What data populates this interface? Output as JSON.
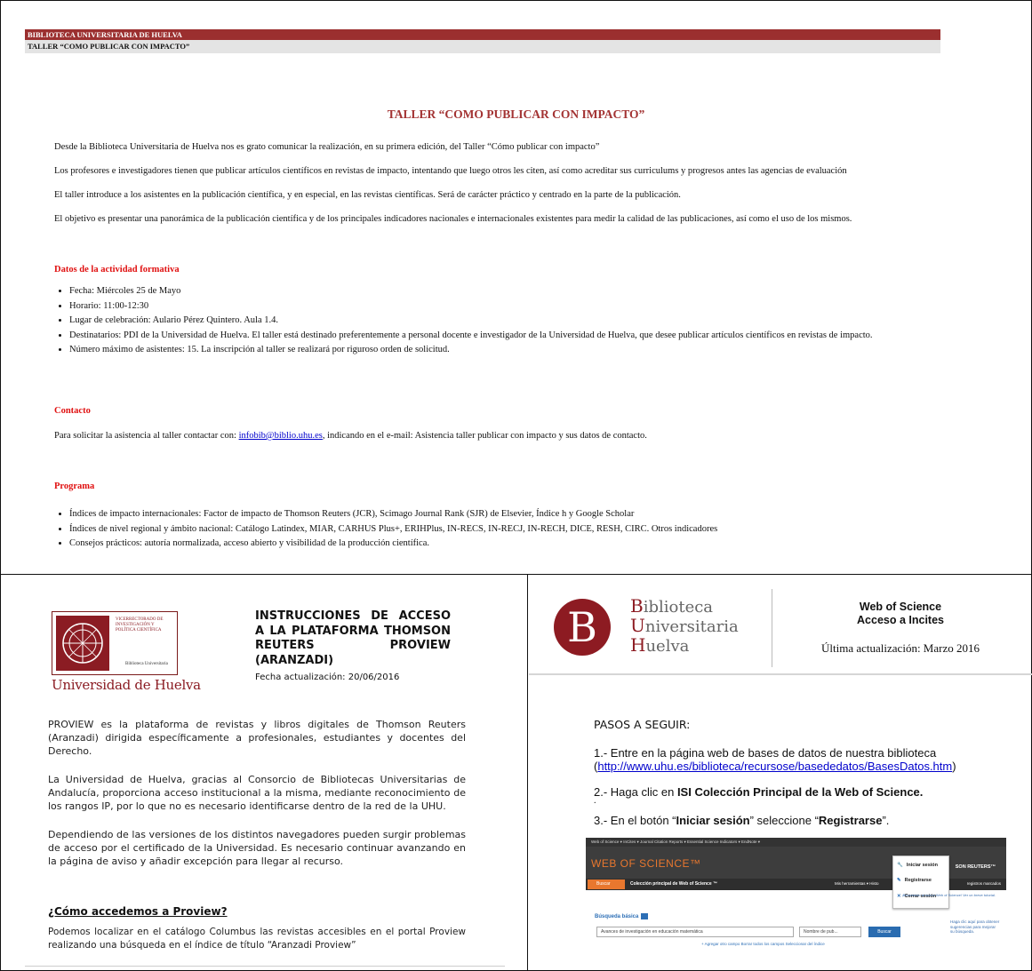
{
  "top": {
    "header_red": "BIBLIOTECA UNIVERSITARIA DE HUELVA",
    "header_grey": "TALLER “COMO PUBLICAR CON IMPACTO”",
    "title": "TALLER “COMO PUBLICAR CON IMPACTO”",
    "paragraphs": [
      "Desde la Biblioteca Universitaria de Huelva nos es grato comunicar la realización, en su primera edición, del Taller “Cómo publicar con impacto”",
      "Los profesores e investigadores tienen que publicar artículos científicos en revistas de impacto, intentando que luego otros les citen, así como acreditar sus curriculums y progresos antes las agencias de evaluación",
      "El taller introduce a los asistentes en la publicación científica, y en especial, en las revistas científicas. Será de carácter práctico y centrado en la parte de la publicación.",
      "El objetivo es presentar una panorámica de la publicación científica y de los principales indicadores nacionales e internacionales existentes para medir la calidad de las publicaciones, así como el uso de los mismos."
    ],
    "section_datos": "Datos de la actividad formativa",
    "datos": [
      "Fecha: Miércoles 25 de Mayo",
      "Horario: 11:00-12:30",
      "Lugar de celebración: Aulario Pérez Quintero. Aula 1.4.",
      "Destinatarios: PDI de la Universidad de Huelva. El taller está destinado preferentemente a personal docente e investigador de la Universidad de Huelva, que desee publicar artículos científicos en revistas de impacto.",
      "Número máximo de asistentes: 15. La inscripción al taller se realizará por riguroso orden de solicitud."
    ],
    "section_contacto": "Contacto",
    "contact_pre": "Para solicitar la asistencia al taller contactar con: ",
    "contact_email": "infobib@biblio.uhu.es",
    "contact_post": ", indicando en el e-mail: Asistencia taller publicar con impacto y sus datos de contacto.",
    "section_programa": "Programa",
    "programa": [
      "Índices de impacto internacionales: Factor de impacto de Thomson Reuters (JCR), Scimago Journal Rank (SJR) de Elsevier, Índice h y Google Scholar",
      "Índices de nivel regional y ámbito nacional: Catálogo Latindex, MIAR, CARHUS Plus+, ERIHPlus, IN-RECS, IN-RECJ, IN-RECH, DICE, RESH, CIRC. Otros indicadores",
      "Consejos prácticos: autoría normalizada, acceso abierto y visibilidad de la producción científica."
    ]
  },
  "bottom_left": {
    "logo_vr": "Vicerrectorado de Investigación y Política Científica",
    "logo_bu": "Biblioteca Universitaria",
    "logo_name": "Universidad de Huelva",
    "title": "INSTRUCCIONES DE ACCESO A LA PLATAFORMA THOMSON REUTERS PROVIEW (ARANZADI)",
    "date": "Fecha actualización: 20/06/2016",
    "p1": "PROVIEW es la plataforma de revistas y libros digitales de Thomson Reuters (Aranzadi) dirigida específicamente a profesionales, estudiantes y docentes del Derecho.",
    "p2": "La Universidad de Huelva, gracias al Consorcio de Bibliotecas Universitarias de Andalucía, proporciona acceso institucional a la misma, mediante reconocimiento de los rangos IP, por lo que no es necesario identificarse dentro de la red de la UHU.",
    "p3": "Dependiendo de las versiones de los distintos navegadores pueden surgir problemas de acceso por el certificado de la Universidad. Es necesario continuar avanzando en la página de aviso y añadir excepción para llegar al recurso.",
    "question": "¿Cómo accedemos a Proview?",
    "p4": "Podemos localizar en el catálogo Columbus las revistas accesibles en el portal Proview realizando una búsqueda en el índice de título “Aranzadi Proview”"
  },
  "bottom_right": {
    "logo_letter": "B",
    "logo_line1_initial": "B",
    "logo_line1_rest": "iblioteca",
    "logo_line2_initial": "U",
    "logo_line2_rest": "niversitaria",
    "logo_line3_initial": "H",
    "logo_line3_rest": "uelva",
    "title_line1": "Web of Science",
    "title_line2": "Acceso a Incites",
    "date": "Última actualización: Marzo 2016",
    "pasos": "PASOS A SEGUIR:",
    "step1_pre": "1.- Entre en la página web de bases de datos de nuestra biblioteca (",
    "step1_link": "http://www.uhu.es/biblioteca/recursose/basededatos/BasesDatos.htm",
    "step1_post": ")",
    "step2_pre": "2.- Haga clic en ",
    "step2_bold": "ISI Colección Principal de la Web of Science.",
    "step_dot": ".",
    "step3_pre": "3.- En el botón “",
    "step3_bold1": "Iniciar sesión",
    "step3_mid": "” seleccione “",
    "step3_bold2": "Registrarse",
    "step3_post": "”.",
    "shot": {
      "topbar": "Web of Science ▾   InCites ▾   Journal Citation Reports ▾   Essential Science Indicators ▾   EndNote ▾",
      "logo": "WEB OF SCIENCE™",
      "tr": "SON REUTERS™",
      "buscar": "Buscar",
      "collection": "Colección principal de Web of Science ™",
      "tools": "Mis herramientas ▾   Histo",
      "menu_login": "Iniciar sesión",
      "menu_register": "Registrarse",
      "menu_logout": "Cerrar sesión",
      "registros": "registros marcados",
      "hint": "¡Bienvenido al nuevo Web of Science! Ver un breve tutorial.",
      "busqueda": "Búsqueda básica",
      "query": "Avances de investigación en educación matemática",
      "field": "Nombre de pub...",
      "search_btn": "Buscar",
      "add": "+ Agregar otro campo    Borrar todos los campos    Seleccionar del índice",
      "side": "Haga clic aquí para obtener sugerencias para mejorar su búsqueda."
    }
  }
}
